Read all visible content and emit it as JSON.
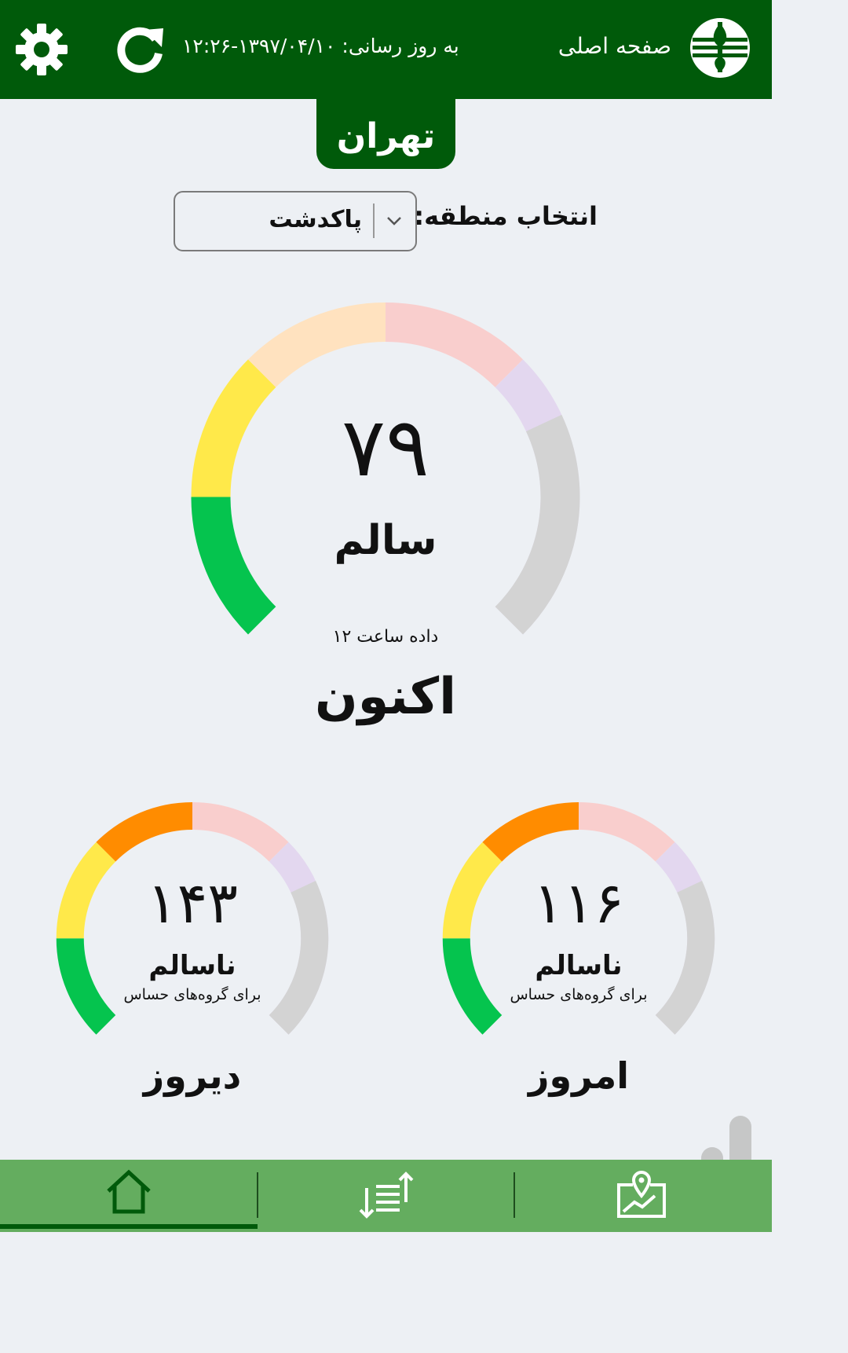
{
  "header": {
    "home_title": "صفحه اصلی",
    "updated_text": "به روز رسانی: ۱۳۹۷/۰۴/۱۰-۱۲:۲۶",
    "icons": [
      "logo-icon",
      "refresh-icon",
      "gear-icon"
    ]
  },
  "city": "تهران",
  "region": {
    "label": "انتخاب منطقه:",
    "selected": "پاکدشت"
  },
  "now": {
    "value": "۷۹",
    "value_num": 79,
    "status": "سالم",
    "note": "داده ساعت ۱۲",
    "label": "اکنون"
  },
  "today": {
    "value": "۱۱۶",
    "value_num": 116,
    "status": "ناسالم",
    "sub": "برای گروه‌های حساس",
    "label": "امروز"
  },
  "yesterday": {
    "value": "۱۴۳",
    "value_num": 143,
    "status": "ناسالم",
    "sub": "برای گروه‌های حساس",
    "label": "دیروز"
  },
  "colors": {
    "header_green": "#005a0a",
    "bar_green": "#64ad5f",
    "good": "#05c44e",
    "moderate": "#ffe94a",
    "sensitive": "#ff8c00",
    "unhealthy": "#e53935",
    "very_unhealthy": "#8e5fbf",
    "inactive": "#d3d3d3"
  },
  "nav": {
    "items": [
      "home-icon",
      "sort-list-icon",
      "map-pin-icon"
    ],
    "active": 0
  }
}
